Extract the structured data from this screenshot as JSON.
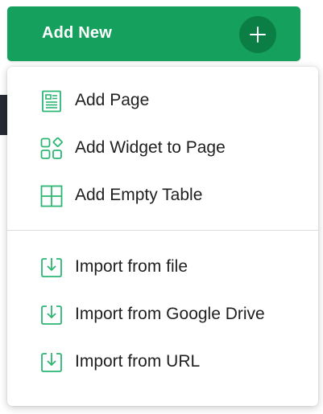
{
  "add_new": {
    "label": "Add New",
    "plus_icon": "plus-icon"
  },
  "menu": {
    "groups": [
      {
        "items": [
          {
            "label": "Add Page",
            "icon": "page-icon"
          },
          {
            "label": "Add Widget to Page",
            "icon": "widgets-icon"
          },
          {
            "label": "Add Empty Table",
            "icon": "table-icon"
          }
        ]
      },
      {
        "items": [
          {
            "label": "Import from file",
            "icon": "import-icon"
          },
          {
            "label": "Import from Google Drive",
            "icon": "import-icon"
          },
          {
            "label": "Import from URL",
            "icon": "import-icon"
          }
        ]
      }
    ]
  },
  "colors": {
    "brand_green": "#16a05d",
    "plus_circle": "#0b7e45",
    "icon_green": "#2bb673",
    "text": "#1f1f1f"
  }
}
